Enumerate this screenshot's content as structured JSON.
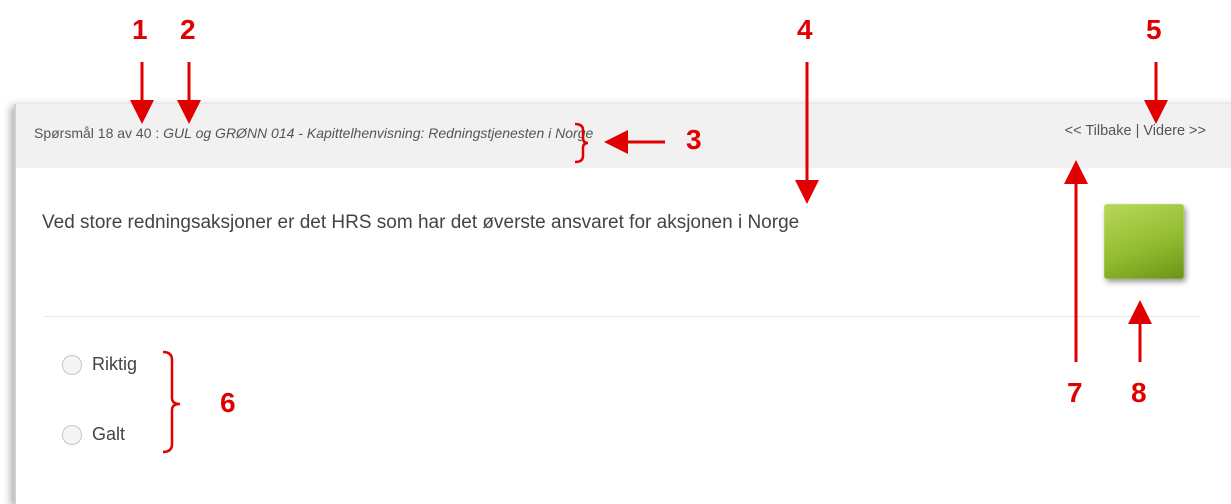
{
  "header": {
    "question_label": "Spørsmål 18 av 40 : ",
    "question_title": "GUL og GRØNN 014 - Kapittelhenvisning: Redningstjenesten i Norge",
    "back_label": "<< Tilbake",
    "separator": " | ",
    "next_label": "Videre >>"
  },
  "question": {
    "text": "Ved store redningsaksjoner er det HRS som har det øverste ansvaret for aksjonen i Norge"
  },
  "options": [
    {
      "label": "Riktig",
      "selected": false
    },
    {
      "label": "Galt",
      "selected": false
    }
  ],
  "annotations": [
    "1",
    "2",
    "3",
    "4",
    "5",
    "6",
    "7",
    "8"
  ],
  "colors": {
    "annotation": "#e00000",
    "header_bg": "#f1f1f1",
    "answer_box": "#93bd30"
  }
}
